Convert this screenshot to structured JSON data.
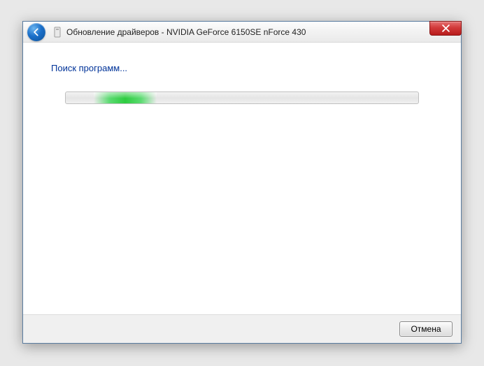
{
  "window": {
    "title": "Обновление драйверов - NVIDIA GeForce 6150SE nForce 430"
  },
  "content": {
    "heading": "Поиск программ..."
  },
  "footer": {
    "cancel_label": "Отмена"
  }
}
